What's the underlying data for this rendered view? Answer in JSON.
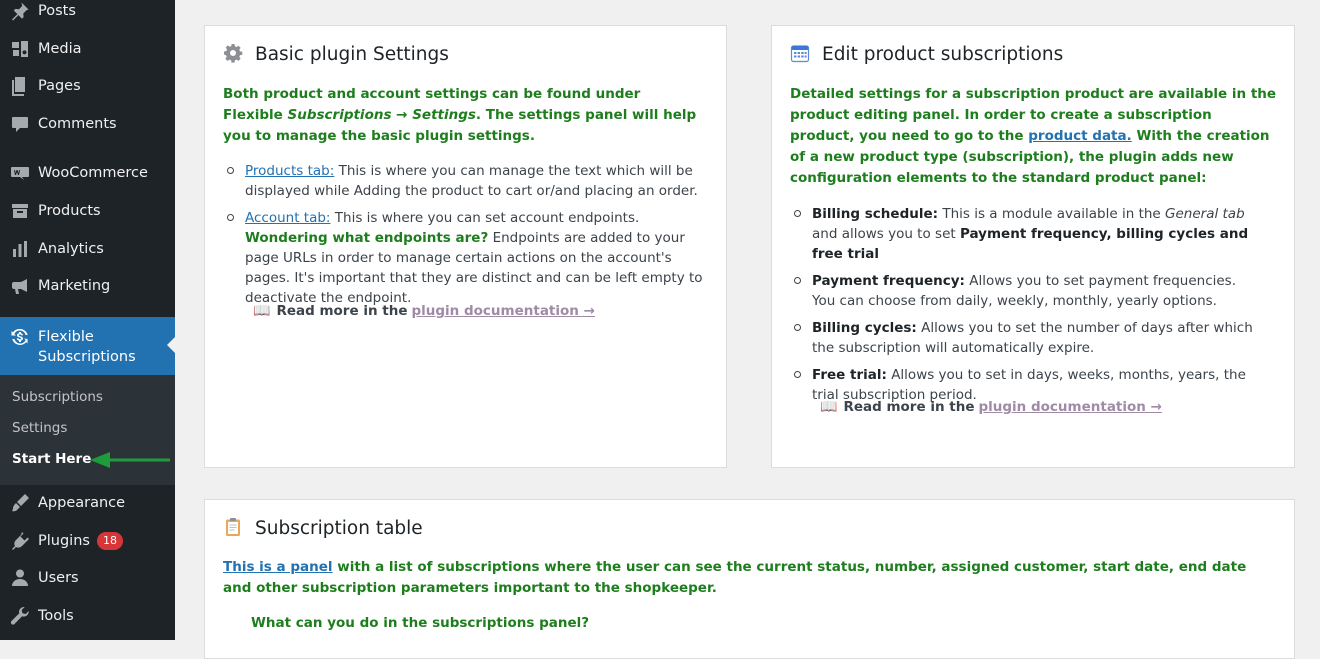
{
  "sidebar": {
    "items": [
      {
        "label": "Posts",
        "icon": "pin-icon"
      },
      {
        "label": "Media",
        "icon": "media-icon"
      },
      {
        "label": "Pages",
        "icon": "pages-icon"
      },
      {
        "label": "Comments",
        "icon": "comments-icon"
      },
      {
        "label": "WooCommerce",
        "icon": "woocommerce-icon"
      },
      {
        "label": "Products",
        "icon": "products-icon"
      },
      {
        "label": "Analytics",
        "icon": "analytics-icon"
      },
      {
        "label": "Marketing",
        "icon": "megaphone-icon"
      },
      {
        "label": "Flexible Subscriptions",
        "icon": "subscriptions-icon"
      },
      {
        "label": "Appearance",
        "icon": "brush-icon"
      },
      {
        "label": "Plugins",
        "icon": "plugin-icon",
        "badge": "18"
      },
      {
        "label": "Users",
        "icon": "users-icon"
      },
      {
        "label": "Tools",
        "icon": "wrench-icon"
      }
    ],
    "submenu": [
      "Subscriptions",
      "Settings",
      "Start Here"
    ],
    "accent": "#2271b1",
    "arrow_color": "#1e9b3a"
  },
  "basic": {
    "title": "Basic plugin Settings",
    "intro_a": "Both product and account settings can be found under Flexible ",
    "intro_em": "Subscriptions → Settings",
    "intro_b": ". The settings panel will help you to manage the basic plugin settings.",
    "bullet1_link": "Products tab:",
    "bullet1_text": " This is where you can manage the text which will be displayed while Adding the product to cart or/and placing an order.",
    "bullet2_link": "Account tab:",
    "bullet2_text": " This is where you can set account endpoints. ",
    "bullet2_green": "Wondering what endpoints are?",
    "bullet2_rest": " Endpoints are added to your page URLs in order to manage certain actions on the account's pages. It's important that they are distinct and can be left empty to deactivate the endpoint.",
    "readmore": "Read more in the",
    "doclink": "plugin documentation →"
  },
  "edit": {
    "title": "Edit product subscriptions",
    "intro_a": "Detailed settings for a subscription product are available in the product editing panel. In order to create a subscription product, you need to go to the ",
    "intro_link": "product data.",
    "intro_b": " With the creation of a new product type (subscription), the plugin adds new configuration elements to the standard product panel:",
    "b1_bold": "Billing schedule:",
    "b1_text": " This is a module available in the ",
    "b1_em": "General tab",
    "b1_text2": " and allows you to set ",
    "b1_bold2": "Payment frequency, billing cycles and free trial",
    "b2_bold": "Payment frequency:",
    "b2_text": " Allows you to set payment frequencies. You can choose from daily, weekly, monthly, yearly options.",
    "b3_bold": "Billing cycles:",
    "b3_text": " Allows you to set the number of days after which the subscription will automatically expire.",
    "b4_bold": "Free trial:",
    "b4_text": " Allows you to set in days, weeks, months, years, the trial subscription period.",
    "readmore": "Read more in the",
    "doclink": "plugin documentation →"
  },
  "table": {
    "title": "Subscription table",
    "intro_link": "This is a panel",
    "intro_text": " with a list of subscriptions where the user can see the current status, number, assigned customer, start date, end date and other subscription parameters important to the shopkeeper.",
    "question": "What can you do in the subscriptions panel?"
  }
}
